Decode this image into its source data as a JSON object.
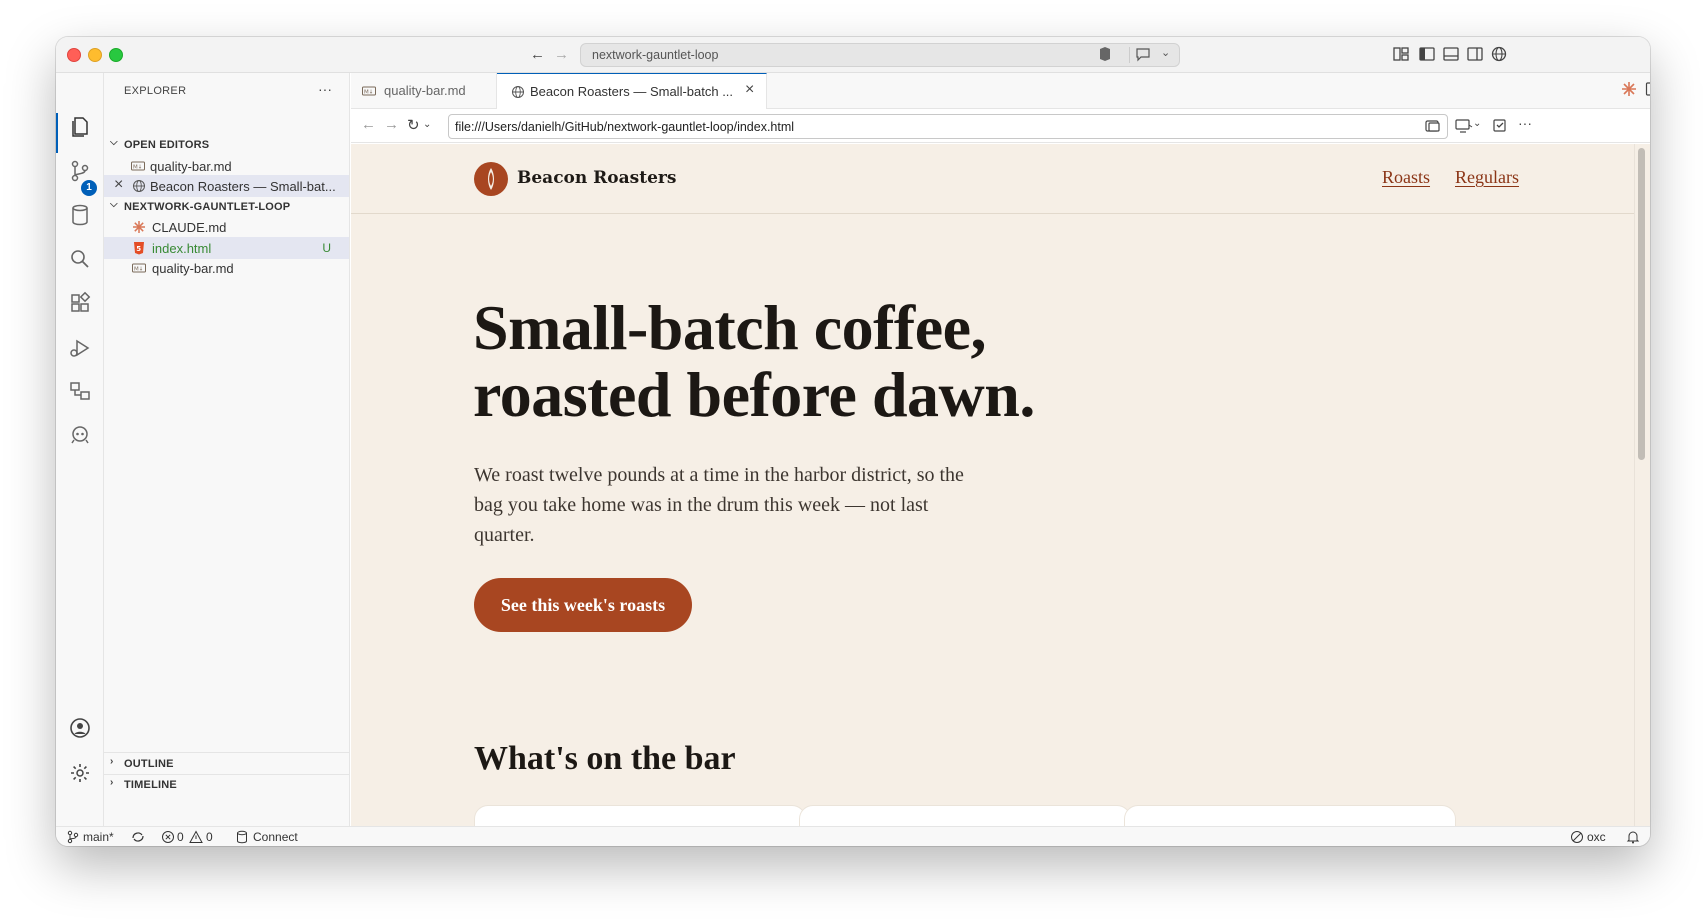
{
  "titlebar": {
    "search_text": "nextwork-gauntlet-loop"
  },
  "sidebar": {
    "title": "EXPLORER",
    "open_editors_label": "OPEN EDITORS",
    "open_editors": [
      {
        "label": "quality-bar.md"
      },
      {
        "label": "Beacon Roasters — Small-bat..."
      }
    ],
    "folder_label": "NEXTWORK-GAUNTLET-LOOP",
    "files": [
      {
        "label": "CLAUDE.md"
      },
      {
        "label": "index.html",
        "status": "U"
      },
      {
        "label": "quality-bar.md"
      }
    ],
    "outline_label": "OUTLINE",
    "timeline_label": "TIMELINE"
  },
  "activity": {
    "scm_badge": "1"
  },
  "tabs": [
    {
      "label": "quality-bar.md"
    },
    {
      "label": "Beacon Roasters — Small-batch ..."
    }
  ],
  "browser": {
    "url": "file:///Users/danielh/GitHub/nextwork-gauntlet-loop/index.html"
  },
  "webpage": {
    "brand": "Beacon Roasters",
    "nav": [
      "Roasts",
      "Regulars"
    ],
    "hero_title_line1": "Small-batch coffee,",
    "hero_title_line2": "roasted before dawn.",
    "hero_sub": "We roast twelve pounds at a time in the harbor district, so the bag you take home was in the drum this week — not last quarter.",
    "cta": "See this week's roasts",
    "section_title": "What's on the bar",
    "brand_color": "#a84621",
    "background_color": "#f6efe6"
  },
  "statusbar": {
    "branch": "main*",
    "errors": "0",
    "warnings": "0",
    "connect": "Connect",
    "right_label": "oxc"
  }
}
